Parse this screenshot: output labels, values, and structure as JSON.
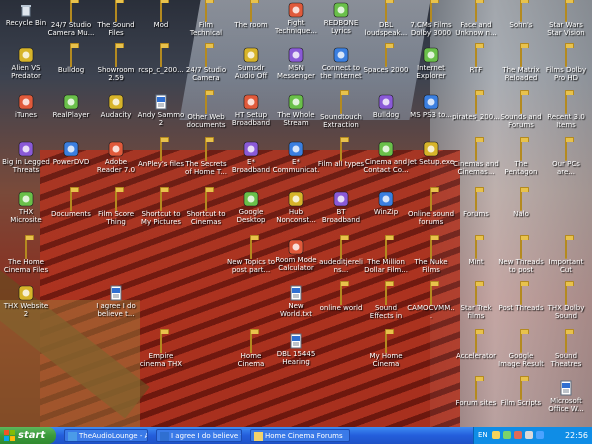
{
  "desktop": {
    "icons": [
      {
        "label": "Recycle Bin",
        "type": "recycle"
      },
      {
        "label": "24/7 Studio Camera Mu...",
        "type": "folder"
      },
      {
        "label": "The Sound Files",
        "type": "folder"
      },
      {
        "label": "Mod",
        "type": "folder"
      },
      {
        "label": "Film Technical Posts_files",
        "type": "folder"
      },
      {
        "label": "The room",
        "type": "folder"
      },
      {
        "label": "Fight Technique...",
        "type": "app"
      },
      {
        "label": "REDBONE Lyrics",
        "type": "app"
      },
      {
        "label": "DBL loudspeak...",
        "type": "folder"
      },
      {
        "label": "7.CMs Films Dolby 3000",
        "type": "folder"
      },
      {
        "label": "Face and Unknow n...",
        "type": "folder"
      },
      {
        "label": "Sohn's",
        "type": "folder"
      },
      {
        "label": "Star Wars Star Vision",
        "type": "folder"
      },
      {
        "label": "Alien VS Predator",
        "type": "app"
      },
      {
        "label": "Bulldog",
        "type": "folder"
      },
      {
        "label": "Showroom 2.59",
        "type": "folder"
      },
      {
        "label": "rcsp_c_200...",
        "type": "folder"
      },
      {
        "label": "24/7 Studio Camera Mus...",
        "type": "folder"
      },
      {
        "label": "Sumsdr Audio Off Website...",
        "type": "app"
      },
      {
        "label": "MSN Messenger 7.5",
        "type": "app"
      },
      {
        "label": "Connect to the Internet",
        "type": "app"
      },
      {
        "label": "Spaces 2000",
        "type": "folder"
      },
      {
        "label": "Internet Explorer",
        "type": "app"
      },
      {
        "label": "RTF",
        "type": "folder"
      },
      {
        "label": "The Matrix Reloaded Cu...",
        "type": "folder"
      },
      {
        "label": "Films Dolby Pro HD",
        "type": "folder"
      },
      {
        "label": "iTunes",
        "type": "app"
      },
      {
        "label": "RealPlayer",
        "type": "app"
      },
      {
        "label": "Audacity",
        "type": "app"
      },
      {
        "label": "Andy Sammo 2",
        "type": "doc"
      },
      {
        "label": "Other Web documents a...",
        "type": "folder"
      },
      {
        "label": "HT Setup Broadband",
        "type": "app"
      },
      {
        "label": "The Whole Stream",
        "type": "app"
      },
      {
        "label": "Soundtouch Extraction",
        "type": "folder"
      },
      {
        "label": "Bulldog",
        "type": "app"
      },
      {
        "label": "MS PS3 to...",
        "type": "app"
      },
      {
        "label": "pirates_200...",
        "type": "folder"
      },
      {
        "label": "Sounds and Forums",
        "type": "folder"
      },
      {
        "label": "Recent 3.0 Items",
        "type": "folder"
      },
      {
        "label": "Big in Legged Threats",
        "type": "app"
      },
      {
        "label": "PowerDVD",
        "type": "app"
      },
      {
        "label": "Adobe Reader 7.0",
        "type": "app"
      },
      {
        "label": "AnPley's files",
        "type": "folder"
      },
      {
        "label": "The Secrets of Home T...",
        "type": "folder"
      },
      {
        "label": "E* Broadband Desktop Hub",
        "type": "app"
      },
      {
        "label": "E* Communicat...",
        "type": "app"
      },
      {
        "label": "Film all types",
        "type": "folder"
      },
      {
        "label": "Cinema and Contact Co...",
        "type": "app"
      },
      {
        "label": "Jet Setup.exe",
        "type": "app"
      },
      {
        "label": "Cinemas and Cinemas...",
        "type": "folder"
      },
      {
        "label": "The Pentagon",
        "type": "folder"
      },
      {
        "label": "Our PCs are...",
        "type": "folder"
      },
      {
        "label": "THX Microsite",
        "type": "app"
      },
      {
        "label": "Documents",
        "type": "folder"
      },
      {
        "label": "Film Score Thing",
        "type": "folder"
      },
      {
        "label": "Shortcut to My Pictures",
        "type": "folder"
      },
      {
        "label": "Shortcut to Cinemas",
        "type": "folder"
      },
      {
        "label": "Google Desktop",
        "type": "app"
      },
      {
        "label": "Hub Nonconst...",
        "type": "app"
      },
      {
        "label": "BT Broadband Talk Setup",
        "type": "app"
      },
      {
        "label": "WinZip",
        "type": "app"
      },
      {
        "label": "Online sound forums",
        "type": "folder"
      },
      {
        "label": "Forums",
        "type": "folder"
      },
      {
        "label": "Nalo",
        "type": "folder"
      },
      {
        "label": "The Home Cinema Files",
        "type": "folder"
      },
      {
        "label": "New Topics to post part...",
        "type": "folder"
      },
      {
        "label": "Room Mode Calculator",
        "type": "app"
      },
      {
        "label": "audeditjerelins...",
        "type": "folder"
      },
      {
        "label": "The Million Dollar Film...",
        "type": "folder"
      },
      {
        "label": "The Nuke Films",
        "type": "folder"
      },
      {
        "label": "Mint",
        "type": "folder"
      },
      {
        "label": "New Threads to post",
        "type": "folder"
      },
      {
        "label": "Important Cut Markers...",
        "type": "folder"
      },
      {
        "label": "THX Website 2",
        "type": "app"
      },
      {
        "label": "I agree I do believe t...",
        "type": "doc"
      },
      {
        "label": "New World.txt",
        "type": "doc"
      },
      {
        "label": "online world",
        "type": "folder"
      },
      {
        "label": "Sound Effects in films",
        "type": "folder"
      },
      {
        "label": "CAMOCVMM...",
        "type": "folder"
      },
      {
        "label": "Star Trek films",
        "type": "folder"
      },
      {
        "label": "Post Threads",
        "type": "folder"
      },
      {
        "label": "THX Dolby Sound",
        "type": "folder"
      },
      {
        "label": "Empire cinema THX big screen",
        "type": "folder"
      },
      {
        "label": "Home Cinema Forums",
        "type": "folder"
      },
      {
        "label": "DBL 15445 Hearing",
        "type": "doc"
      },
      {
        "label": "My Home Cinema",
        "type": "folder"
      },
      {
        "label": "Accelerator",
        "type": "folder"
      },
      {
        "label": "Google Image Result for ht...",
        "type": "folder"
      },
      {
        "label": "Sound Theatres",
        "type": "folder"
      },
      {
        "label": "Forum sites",
        "type": "folder"
      },
      {
        "label": "Film Scripts",
        "type": "folder"
      },
      {
        "label": "Microsoft Office W...",
        "type": "doc"
      }
    ]
  },
  "taskbar": {
    "start_label": "start",
    "tasks": [
      {
        "label": "TheAudioLounge - A..."
      },
      {
        "label": "I agree I do believe t..."
      },
      {
        "label": "Home Cinema Forums"
      }
    ],
    "tray": {
      "language": "EN",
      "clock": "22:56"
    }
  }
}
